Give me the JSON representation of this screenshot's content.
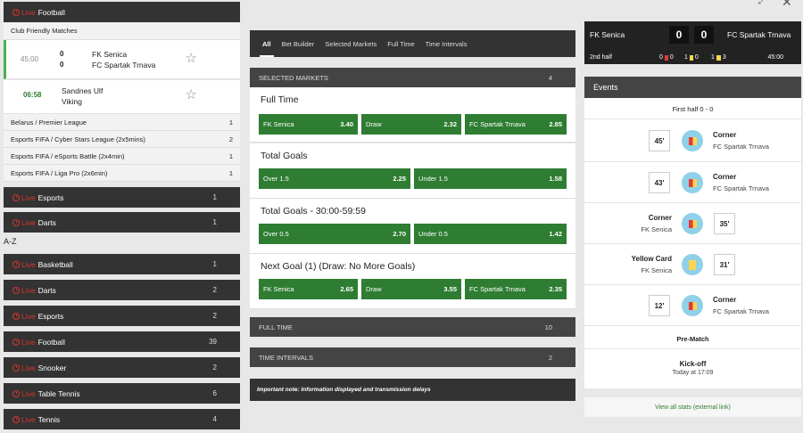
{
  "left": {
    "live_label": "Live",
    "top_sport": "Football",
    "group": "Club Friendly Matches",
    "matches": [
      {
        "time": "45:00",
        "home_score": "0",
        "away_score": "0",
        "home": "FK Senica",
        "away": "FC Spartak Trnava"
      },
      {
        "time": "06:58",
        "home_score": "",
        "away_score": "",
        "home": "Sandnes Ulf",
        "away": "Viking"
      }
    ],
    "leagues": [
      {
        "name": "Belarus / Premier League",
        "count": "1"
      },
      {
        "name": "Esports FIFA / Cyber Stars League (2x5mins)",
        "count": "2"
      },
      {
        "name": "Esports FIFA / eSports Battle (2x4min)",
        "count": "1"
      },
      {
        "name": "Esports FIFA / Liga Pro (2x6min)",
        "count": "1"
      }
    ],
    "live_sports_top": [
      {
        "name": "Esports",
        "count": "1"
      },
      {
        "name": "Darts",
        "count": "1"
      }
    ],
    "az_label": "A-Z",
    "az_sports": [
      {
        "name": "Basketball",
        "count": "1"
      },
      {
        "name": "Darts",
        "count": "2"
      },
      {
        "name": "Esports",
        "count": "2"
      },
      {
        "name": "Football",
        "count": "39"
      },
      {
        "name": "Snooker",
        "count": "2"
      },
      {
        "name": "Table Tennis",
        "count": "6"
      },
      {
        "name": "Tennis",
        "count": "4"
      }
    ]
  },
  "middle": {
    "tabs": [
      "All",
      "Bet Builder",
      "Selected Markets",
      "Full Time",
      "Time Intervals"
    ],
    "selected_markets": {
      "label": "SELECTED MARKETS",
      "count": "4"
    },
    "markets": [
      {
        "title": "Full Time",
        "odds": [
          {
            "label": "FK Senica",
            "price": "3.40"
          },
          {
            "label": "Draw",
            "price": "2.32"
          },
          {
            "label": "FC Spartak Trnava",
            "price": "2.85"
          }
        ]
      },
      {
        "title": "Total Goals",
        "odds": [
          {
            "label": "Over 1.5",
            "price": "2.25"
          },
          {
            "label": "Under 1.5",
            "price": "1.58"
          }
        ]
      },
      {
        "title": "Total Goals - 30:00-59:59",
        "odds": [
          {
            "label": "Over 0.5",
            "price": "2.70"
          },
          {
            "label": "Under 0.5",
            "price": "1.42"
          }
        ]
      },
      {
        "title": "Next Goal (1) (Draw: No More Goals)",
        "odds": [
          {
            "label": "FK Senica",
            "price": "2.65"
          },
          {
            "label": "Draw",
            "price": "3.55"
          },
          {
            "label": "FC Spartak Trnava",
            "price": "2.35"
          }
        ]
      }
    ],
    "full_time": {
      "label": "FULL TIME",
      "count": "10"
    },
    "time_intervals": {
      "label": "TIME INTERVALS",
      "count": "2"
    },
    "note": "Important note: Information displayed and transmission delays"
  },
  "right": {
    "home": "FK Senica",
    "away": "FC Spartak Trnava",
    "home_score": "0",
    "away_score": "0",
    "period": "2nd half",
    "stat_red": "0",
    "stat_red2": "0",
    "stat_yellow": "1",
    "stat_yellow2": "0",
    "stat_corner": "1",
    "stat_corner2": "3",
    "clock": "45:00",
    "events_label": "Events",
    "first_half": "First half 0 - 0",
    "events": [
      {
        "minute": "45'",
        "type": "Corner",
        "team": "FC Spartak Trnava",
        "side": "away",
        "icon": "corner-flag-icon"
      },
      {
        "minute": "43'",
        "type": "Corner",
        "team": "FC Spartak Trnava",
        "side": "away",
        "icon": "corner-flag-icon"
      },
      {
        "minute": "35'",
        "type": "Corner",
        "team": "FK Senica",
        "side": "home",
        "icon": "corner-flag-icon"
      },
      {
        "minute": "31'",
        "type": "Yellow Card",
        "team": "FK Senica",
        "side": "home",
        "icon": "yellow-card-icon"
      },
      {
        "minute": "12'",
        "type": "Corner",
        "team": "FC Spartak Trnava",
        "side": "away",
        "icon": "corner-flag-icon"
      }
    ],
    "pre_match": "Pre-Match",
    "kickoff_label": "Kick-off",
    "kickoff_time": "Today at 17:09",
    "stats_link": "View all stats (external link)"
  },
  "colors": {
    "odds_green": "#2e7d32",
    "live_red": "#d9342b",
    "dark_bar": "#333333"
  }
}
